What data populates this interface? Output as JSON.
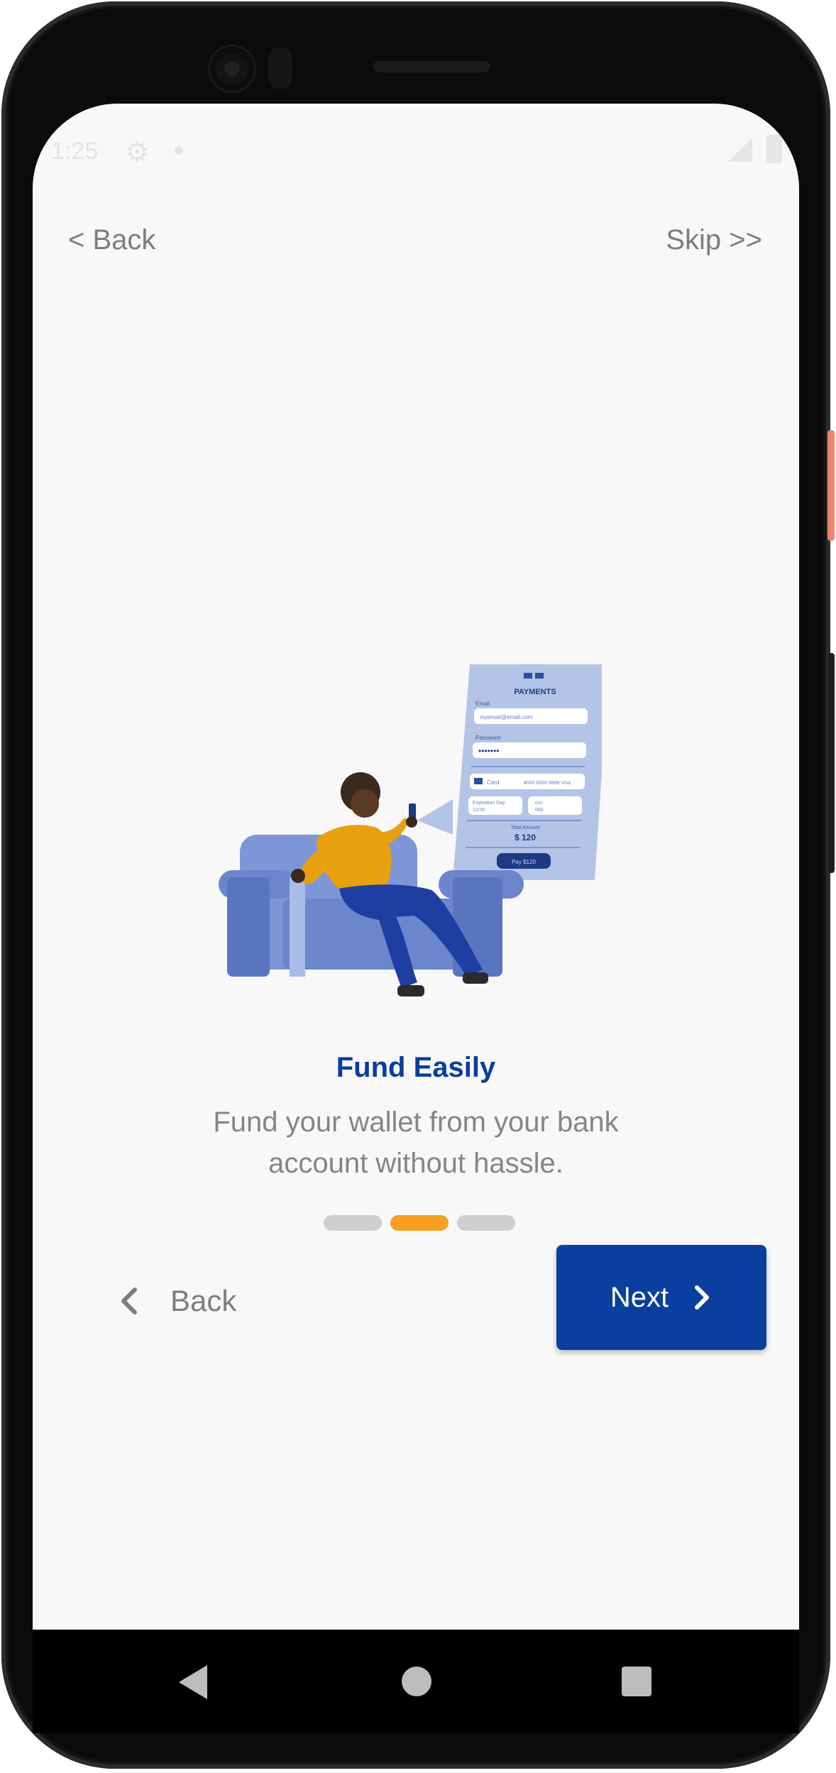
{
  "status_bar": {
    "time": "1:25"
  },
  "header": {
    "back_label": "< Back",
    "skip_label": "Skip >>"
  },
  "onboarding": {
    "title": "Fund Easily",
    "description": "Fund your wallet from your bank account without hassle.",
    "page_indicator": {
      "total": 3,
      "active_index": 1
    },
    "illustration": {
      "card_title": "PAYMENTS",
      "email_label": "Email",
      "email_value": "myemail@email.com",
      "password_label": "Password",
      "password_value": "•••••••",
      "card_label": "Card",
      "card_number": "4000 0000 8888 Visa",
      "expiry_label": "Expiration Day",
      "expiry_value": "12/30",
      "cvv_label": "cvv",
      "cvv_value": "000",
      "amount_label": "Total Amount",
      "amount_value": "$ 120",
      "pay_button": "Pay $120"
    }
  },
  "footer": {
    "back_label": "Back",
    "next_label": "Next"
  },
  "colors": {
    "primary": "#0b3f9f",
    "accent": "#f5a022",
    "title": "#0b3d9c",
    "muted_text": "#858585",
    "background": "#f8f8f8"
  }
}
